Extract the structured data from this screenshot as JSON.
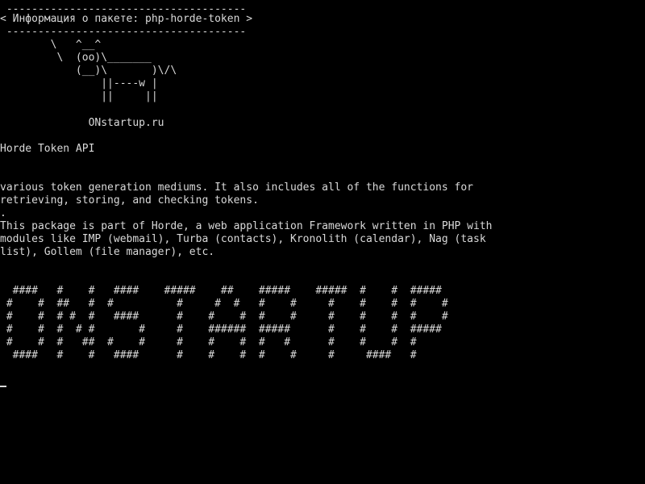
{
  "terminal": {
    "cowsay": {
      "top_border": " --------------------------------------",
      "title": "< Информация о пакете: php-horde-token >",
      "bottom_border": " --------------------------------------",
      "cow": [
        "        \\   ^__^",
        "         \\  (oo)\\_______",
        "            (__)\\       )\\/\\",
        "                ||----w |",
        "                ||     ||"
      ],
      "site": "              ONstartup.ru"
    },
    "description": {
      "summary": "Horde Token API",
      "lines": [
        "various token generation mediums. It also includes all of the functions for",
        "retrieving, storing, and checking tokens.",
        ".",
        "This package is part of Horde, a web application Framework written in PHP with",
        "modules like IMP (webmail), Turba (contacts), Kronolith (calendar), Nag (task",
        "list), Gollem (file manager), etc."
      ]
    },
    "banner": [
      "  ####   #    #   ####    #####    ##    #####    #####  #    #  #####",
      " #    #  ##   #  #          #     #  #   #    #     #    #    #  #    #",
      " #    #  # #  #   ####      #    #    #  #    #     #    #    #  #    #",
      " #    #  #  # #       #     #    ######  #####      #    #    #  #####",
      " #    #  #   ##  #    #     #    #    #  #   #      #    #    #  #",
      "  ####   #    #   ####      #    #    #  #    #     #     ####   #"
    ]
  }
}
